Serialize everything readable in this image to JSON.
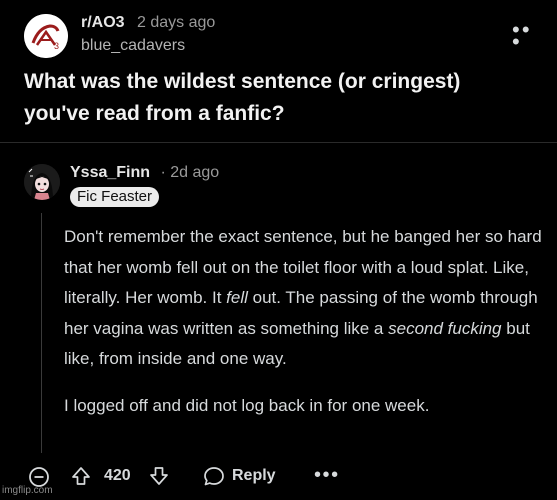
{
  "post": {
    "subreddit": "r/AO3",
    "time": "2 days ago",
    "author": "blue_cadavers",
    "title": "What was the wildest sentence (or cringest) you've read from a fanfic?",
    "more_icon": "ellipsis-icon"
  },
  "comment": {
    "username": "Yssa_Finn",
    "separator": "·",
    "time": "2d ago",
    "flair": "Fic Feaster",
    "body": {
      "p1_a": "Don't remember the exact sentence, but he banged her so hard that her womb fell out on the toilet floor with a loud splat. Like, literally. Her womb. It ",
      "p1_em1": "fell",
      "p1_b": " out. The passing of the womb through her vagina was written as something like a ",
      "p1_em2": "second fucking",
      "p1_c": " but like, from inside and one way.",
      "p2": "I logged off and did not log back in for one week."
    },
    "actions": {
      "score": "420",
      "reply_label": "Reply",
      "icons": [
        "collapse-icon",
        "upvote-icon",
        "downvote-icon",
        "reply-icon",
        "ellipsis-icon"
      ]
    }
  },
  "watermark": "imgflip.com"
}
